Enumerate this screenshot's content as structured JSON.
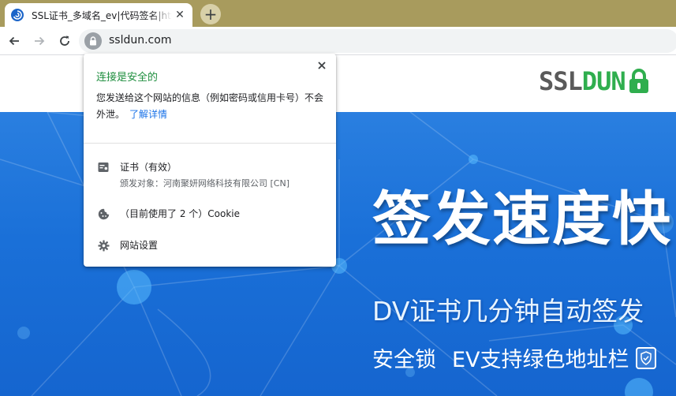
{
  "browser": {
    "tab": {
      "title": "SSL证书_多域名_ev|代码签名|https",
      "close_symbol": "✕"
    },
    "new_tab_symbol": "+",
    "address_bar": {
      "url": "ssldun.com"
    }
  },
  "site": {
    "logo": {
      "part1": "SSL",
      "part2": "DUN"
    },
    "hero": {
      "title": "签发速度快",
      "subtitle": "DV证书几分钟自动签发",
      "feature_1": "安全锁",
      "feature_2": "EV支持绿色地址栏"
    }
  },
  "page_info_popup": {
    "title": "连接是安全的",
    "description": "您发送给这个网站的信息（例如密码或信用卡号）不会外泄。",
    "learn_more": "了解详情",
    "certificate": {
      "label": "证书（有效）",
      "issued_to": "颁发对象：河南聚妍网络科技有限公司 [CN]"
    },
    "cookies": {
      "label": "（目前使用了 2 个）Cookie"
    },
    "site_settings": {
      "label": "网站设置"
    }
  },
  "colors": {
    "secure_green": "#1e8e3e",
    "link_blue": "#1a73e8",
    "titlebar": "#a89b5d",
    "hero_blue": "#1a70d8",
    "logo_gray": "#5a5a5a",
    "logo_green": "#2fae4e"
  }
}
